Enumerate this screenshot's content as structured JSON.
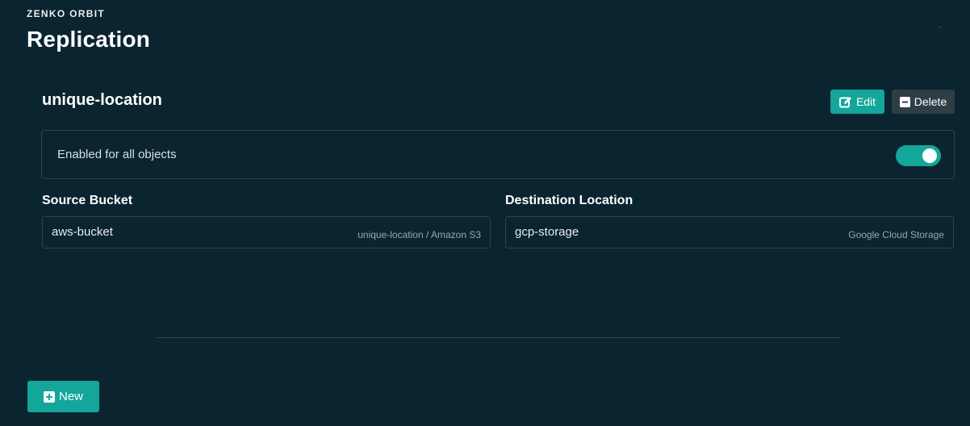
{
  "app": {
    "brand": "ZENKO ORBIT"
  },
  "page": {
    "title": "Replication"
  },
  "rule": {
    "name": "unique-location",
    "actions": {
      "edit_label": "Edit",
      "delete_label": "Delete"
    },
    "scope": {
      "label": "Enabled for all objects",
      "enabled": true
    },
    "source": {
      "label": "Source Bucket",
      "value": "aws-bucket",
      "hint": "unique-location / Amazon S3"
    },
    "destination": {
      "label": "Destination Location",
      "value": "gcp-storage",
      "hint": "Google Cloud Storage"
    }
  },
  "footer": {
    "new_label": "New"
  },
  "icons": {
    "edit": "edit-icon",
    "delete": "minus-square-icon",
    "new": "plus-square-icon"
  },
  "colors": {
    "background": "#0a2430",
    "accent": "#14a69a",
    "secondary_button": "#2f3e46",
    "border": "#2a4450"
  }
}
